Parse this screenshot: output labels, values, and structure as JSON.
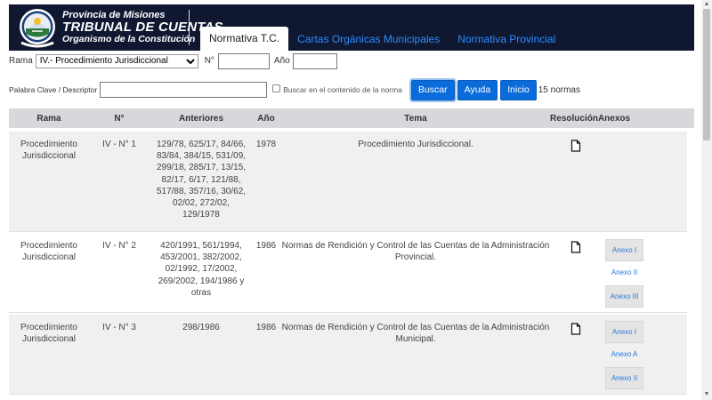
{
  "header": {
    "line1": "Provincia de Misiones",
    "line2": "TRIBUNAL DE CUENTAS",
    "line3": "Organismo de la Constitución",
    "nav": [
      "Normativa T.C.",
      "Cartas Orgánicas Municipales",
      "Normativa Provincial"
    ]
  },
  "filters": {
    "rama_label": "Rama",
    "rama_value": "IV.- Procedimiento Jurisdiccional",
    "n_label": "N°",
    "ano_label": "Año",
    "keyword_label": "Palabra Clave / Descriptor",
    "content_checkbox_label": "Buscar en el contenido de la norma",
    "buscar": "Buscar",
    "ayuda": "Ayuda",
    "inicio": "Inicio",
    "count": "15 normas"
  },
  "table": {
    "columns": [
      "Rama",
      "N°",
      "Anteriores",
      "Año",
      "Tema",
      "Resolución",
      "Anexos"
    ],
    "rows": [
      {
        "rama": [
          "Procedimiento",
          "Jurisdiccional"
        ],
        "numero": "IV - N° 1",
        "anteriores": [
          "129/78, 625/17, 84/66,",
          "83/84, 384/15, 531/09,",
          "299/18, 285/17, 13/15,",
          "82/17, 6/17, 121/88,",
          "517/88, 357/16, 30/62,",
          "02/02, 272/02,",
          "129/1978"
        ],
        "ano": "1978",
        "tema": [
          "Procedimiento Jurisdiccional."
        ],
        "anexos": []
      },
      {
        "rama": [
          "Procedimiento",
          "Jurisdiccional"
        ],
        "numero": "IV - N° 2",
        "anteriores": [
          "420/1991, 561/1994,",
          "453/2001, 382/2002,",
          "02/1992, 17/2002,",
          "269/2002, 194/1986 y",
          "otras"
        ],
        "ano": "1986",
        "tema": [
          "Normas de Rendición y Control de las Cuentas de la Administración",
          "Provincial."
        ],
        "anexos": [
          "Anexo I",
          "Anexo II",
          "Anexo III"
        ]
      },
      {
        "rama": [
          "Procedimiento",
          "Jurisdiccional"
        ],
        "numero": "IV - N° 3",
        "anteriores": [
          "298/1986"
        ],
        "ano": "1986",
        "tema": [
          "Normas de Rendición y Control de las Cuentas de la Administración",
          "Municipal."
        ],
        "anexos": [
          "Anexo I",
          "Anexo A",
          "Anexo II"
        ]
      }
    ]
  },
  "icons": {
    "seal": "coat-of-arms-icon",
    "resolution": "document-icon"
  },
  "colors": {
    "header_bg": "#0f1830",
    "link": "#2b8cff",
    "button": "#0a6cdb",
    "table_header": "#d6d8db",
    "row_alt": "#f0f0f0"
  }
}
